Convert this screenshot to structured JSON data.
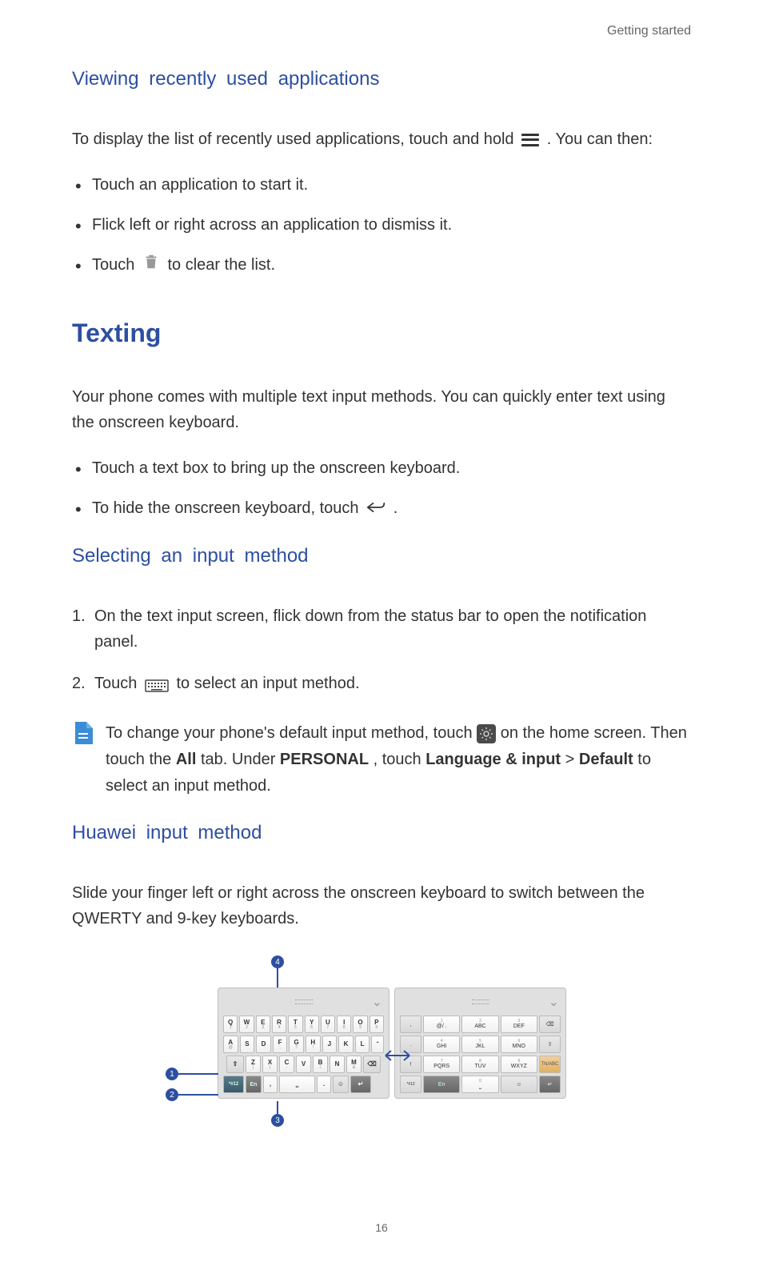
{
  "header": "Getting started",
  "pageNumber": "16",
  "section1": {
    "title": "Viewing recently used applications",
    "para_before_icon": "To display the list of recently used applications, touch and hold ",
    "para_after_icon": " . You can then:",
    "bullets": [
      "Touch an application to start it.",
      "Flick left or right across an application to dismiss it."
    ],
    "bullet3_before": "Touch ",
    "bullet3_after": " to clear the list."
  },
  "section2": {
    "title": "Texting",
    "para": "Your phone comes with multiple text input methods. You can quickly enter text using the onscreen keyboard.",
    "bullet1": "Touch a text box to bring up the onscreen keyboard.",
    "bullet2_before": "To hide the onscreen keyboard, touch ",
    "bullet2_after": " ."
  },
  "section3": {
    "title": "Selecting an input method",
    "step1_full": "On the text input screen, flick down from the status bar to open the notification panel.",
    "step2_before": "Touch ",
    "step2_after": " to select an input method.",
    "note_before": "To change your phone's default input method, touch ",
    "note_mid1": " on the home screen. Then touch the ",
    "note_all": "All",
    "note_mid2": " tab. Under ",
    "note_personal": "PERSONAL",
    "note_mid3": ", touch ",
    "note_lang": "Language & input",
    "note_gt": " > ",
    "note_default": "Default",
    "note_after": " to select an input method."
  },
  "section4": {
    "title": "Huawei input method",
    "para": "Slide your finger left or right across the onscreen keyboard to switch between the QWERTY and 9-key keyboards."
  },
  "keyboard": {
    "qwerty_row1": [
      "Q",
      "W",
      "E",
      "R",
      "T",
      "Y",
      "U",
      "I",
      "O",
      "P"
    ],
    "qwerty_row1_sub": [
      "1",
      "2",
      "3",
      "4",
      "5",
      "6",
      "7",
      "8",
      "9",
      "0"
    ],
    "qwerty_row2": [
      "A",
      "S",
      "D",
      "F",
      "G",
      "H",
      "J",
      "K",
      "L"
    ],
    "qwerty_row2_sub": [
      "@",
      "",
      "",
      ";",
      "?",
      "!",
      "",
      "",
      ""
    ],
    "qwerty_row3": [
      "Z",
      "X",
      "C",
      "V",
      "B",
      "N",
      "M"
    ],
    "qwerty_row3_sub": [
      "(",
      ")",
      "-",
      "",
      "/",
      "",
      "&"
    ],
    "sym_label": "*#12",
    "en_label": "En",
    "comma": ",",
    "period": ".",
    "ninekey": {
      "r1": [
        ",",
        "@/ .",
        "ABC",
        "DEF"
      ],
      "r1_top": [
        "",
        "1",
        "2",
        "3"
      ],
      "r2": [
        ".",
        "GHI",
        "JKL",
        "MNO"
      ],
      "r2_top": [
        "",
        "4",
        "5",
        "6"
      ],
      "r3": [
        "!",
        "PQRS",
        "TUV",
        "WXYZ"
      ],
      "r3_top": [
        "",
        "7",
        "8",
        "9"
      ],
      "r4_zero": "0",
      "tnabc": "TN/ABC"
    },
    "callouts": {
      "c1": "1",
      "c2": "2",
      "c3": "3",
      "c4": "4"
    }
  }
}
